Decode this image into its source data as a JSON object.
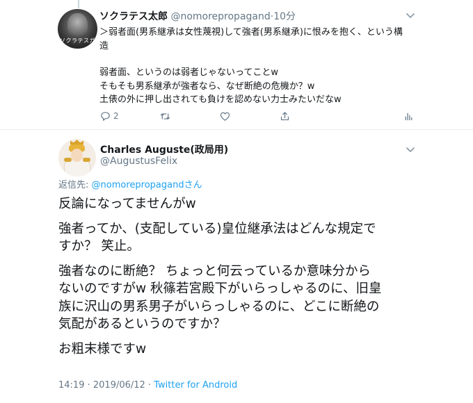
{
  "parent_tweet": {
    "display_name": "ソクラテス太郎",
    "handle": "@nomorepropagand",
    "separator": "·",
    "time": "10分",
    "avatar_caption": "ソクラテスガ",
    "body_lines": [
      "＞弱者面(男系継承は女性蔑視)して強者(男系継承)に恨みを抱く、という構",
      "造",
      "",
      "弱者面、というのは弱者じゃないってことw",
      "そもそも男系継承が強者なら、なぜ断絶の危機か？w",
      "土俵の外に押し出されても負けを認めない力士みたいだなw"
    ],
    "actions": {
      "reply_count": "2",
      "retweet_count": "",
      "like_count": ""
    }
  },
  "focused_tweet": {
    "display_name": "Charles Auguste(政局用)",
    "handle": "@AugustusFelix",
    "reply_prefix": "返信先: ",
    "reply_mention": "@nomorepropagand",
    "reply_suffix": "さん",
    "paragraphs": [
      [
        "反論になってませんがw"
      ],
      [
        "強者ってか、(支配している)皇位継承法はどんな規定で",
        "すか？ 笑止。"
      ],
      [
        "強者なのに断絶？ ちょっと何云っているか意味分から",
        "ないのですがw 秋篠若宮殿下がいらっしゃるのに、旧皇",
        "族に沢山の男系男子がいらっしゃるのに、どこに断絶の",
        "気配があるというのですか？"
      ],
      [
        "お粗末様ですw"
      ]
    ],
    "meta": {
      "time": "14:19",
      "date": "2019/06/12",
      "separator": "·",
      "source": "Twitter for Android"
    }
  },
  "colors": {
    "text": "#14171a",
    "secondary": "#657786",
    "link": "#1da1f2",
    "divider": "#e6ecf0"
  }
}
